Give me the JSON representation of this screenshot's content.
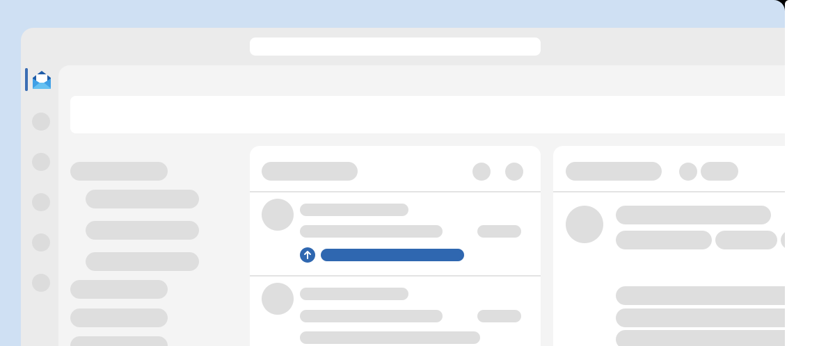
{
  "app": {
    "logo_icon": "mail-open-envelope-icon",
    "accent_color": "#2f67b0",
    "rail_indicator_color": "#3b6db3",
    "background_color": "#cfe0f3"
  },
  "upload": {
    "icon": "arrow-up-icon",
    "progress": 1.0
  }
}
